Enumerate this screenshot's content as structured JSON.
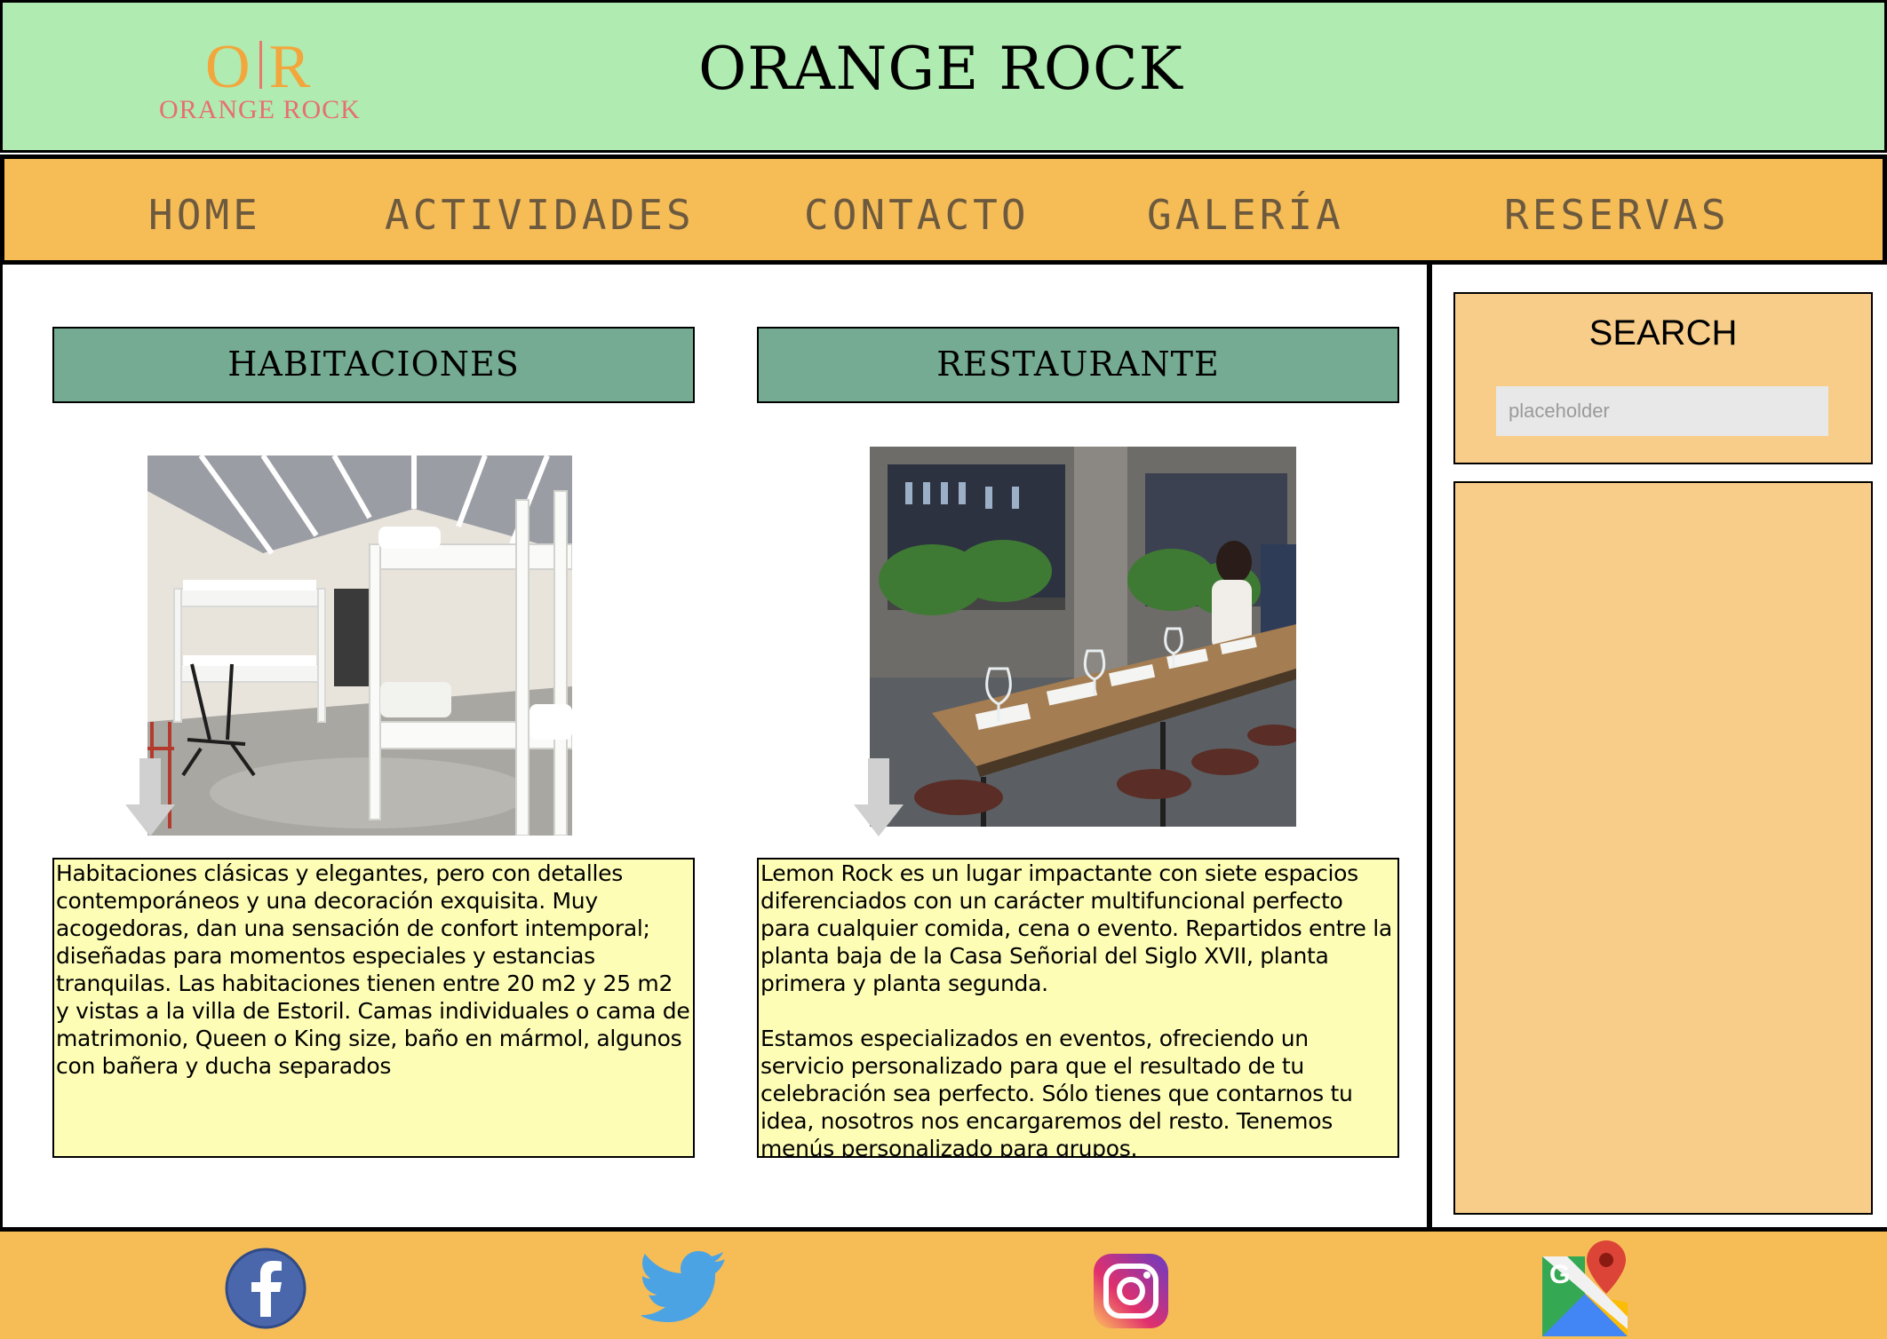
{
  "header": {
    "logo_mark_left": "O",
    "logo_mark_right": "R",
    "logo_text": "ORANGE ROCK",
    "title": "ORANGE ROCK"
  },
  "nav": {
    "items": [
      {
        "label": "HOME"
      },
      {
        "label": "ACTIVIDADES"
      },
      {
        "label": "CONTACTO"
      },
      {
        "label": "GALERÍA"
      },
      {
        "label": "RESERVAS"
      }
    ]
  },
  "main": {
    "habitaciones": {
      "title": "HABITACIONES",
      "description": "Habitaciones clásicas y elegantes, pero con detalles contemporáneos y una decoración exquisita. Muy acogedoras, dan una sensación de confort intemporal; diseñadas para momentos especiales y estancias tranquilas. Las habitaciones tienen entre 20 m2 y 25 m2 y vistas a la villa de Estoril. Camas individuales o cama de matrimonio, Queen o King size, baño en mármol, algunos con bañera y ducha separados"
    },
    "restaurante": {
      "title": "RESTAURANTE",
      "paragraph_1": "Lemon Rock es un lugar impactante con siete espacios diferenciados con un carácter multifuncional perfecto para cualquier comida, cena o evento. Repartidos entre la planta baja de la Casa Señorial del Siglo XVII, planta primera y planta segunda.",
      "paragraph_2": "Estamos especializados en eventos, ofreciendo un servicio personalizado para que el resultado de tu celebración sea perfecto. Sólo tienes que contarnos tu idea, nosotros nos encargaremos del resto. Tenemos menús personalizado para grupos."
    }
  },
  "sidebar": {
    "search_title": "SEARCH",
    "search_placeholder": "placeholder"
  },
  "footer": {
    "icons": [
      "facebook-icon",
      "twitter-icon",
      "instagram-icon",
      "google-maps-icon"
    ]
  },
  "colors": {
    "header_bg": "#b0ebb1",
    "nav_bg": "#f6bd57",
    "section_header_bg": "#75ab93",
    "textbox_bg": "#fdfdb6",
    "sidebar_bg": "#f7cd89",
    "logo_orange": "#f3a63b",
    "logo_red": "#e76f6f"
  }
}
